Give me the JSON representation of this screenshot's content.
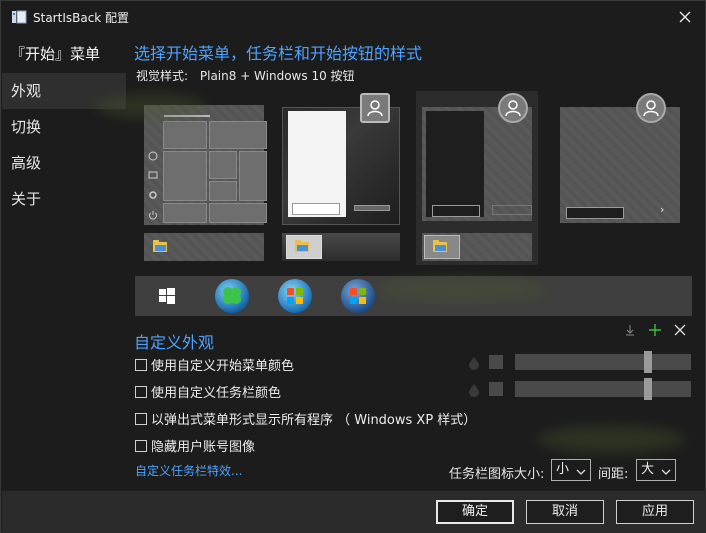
{
  "window": {
    "title": "StartIsBack 配置",
    "icon": "startisback-app-icon",
    "close_icon": "close-icon"
  },
  "sidebar": {
    "header": "『开始』菜单",
    "items": [
      {
        "label": "外观",
        "active": true
      },
      {
        "label": "切换",
        "active": false
      },
      {
        "label": "高级",
        "active": false
      },
      {
        "label": "关于",
        "active": false
      }
    ]
  },
  "appearance": {
    "heading": "选择开始菜单，任务栏和开始按钮的样式",
    "visual_style_label": "视觉样式:",
    "visual_style_value": "Plain8 + Windows 10 按钮"
  },
  "customize": {
    "heading": "自定义外观",
    "options": [
      {
        "label": "使用自定义开始菜单颜色",
        "checked": false
      },
      {
        "label": "使用自定义任务栏颜色",
        "checked": false
      },
      {
        "label": "以弹出式菜单形式显示所有程序 （ Windows XP 样式）",
        "checked": false
      },
      {
        "label": "隐藏用户账号图像",
        "checked": false
      }
    ],
    "taskbar_effects_link": "自定义任务栏特效...",
    "icon_size_label": "任务栏图标大小:",
    "icon_size_value": "小",
    "spacing_label": "间距:",
    "spacing_value": "大",
    "menu_color_slider": 0.77,
    "taskbar_color_slider": 0.77
  },
  "footer": {
    "ok": "确定",
    "cancel": "取消",
    "apply": "应用"
  },
  "colors": {
    "accent": "#4ea3ff",
    "background": "#1c1c1c",
    "footer": "#2b2b2b"
  }
}
